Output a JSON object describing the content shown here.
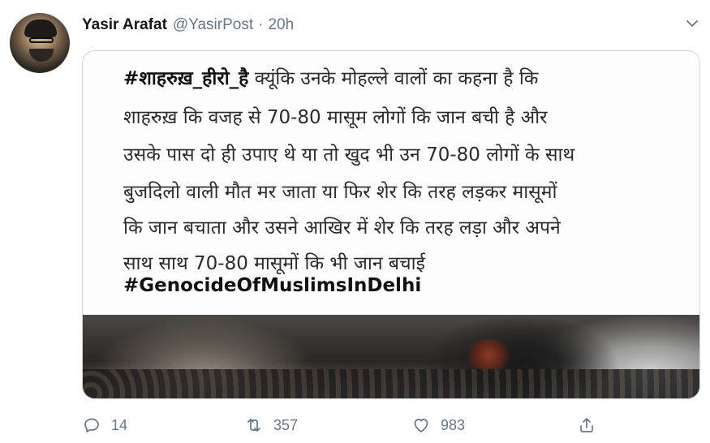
{
  "tweet": {
    "author": {
      "name": "Yasir Arafat",
      "handle": "@YasirPost",
      "separator": "·",
      "time": "20h"
    },
    "media_text": {
      "line1_hashtag": "#शाहरुख़_हीरो_है",
      "line1_rest": " क्यूंकि उनके मोहल्ले वालों का कहना है कि",
      "line2": "शाहरुख़ कि वजह से 70-80 मासूम लोगों कि जान बची है और",
      "line3": "उसके पास दो ही उपाए थे या तो खुद भी उन 70-80 लोगों के साथ",
      "line4": "बुजदिलो वाली मौत मर जाता या फिर शेर कि तरह लड़कर मासूमों",
      "line5": "कि जान बचाता और उसने आखिर में शेर कि तरह लड़ा और अपने",
      "line6": "साथ साथ 70-80 मासूमों कि भी जान बचाई",
      "line7": "#GenocideOfMuslimsInDelhi"
    },
    "actions": {
      "reply_count": "14",
      "retweet_count": "357",
      "like_count": "983"
    },
    "icons": {
      "more": "chevron-down-icon",
      "reply": "reply-icon",
      "retweet": "retweet-icon",
      "like": "heart-icon",
      "share": "share-icon"
    },
    "colors": {
      "secondary_text": "#657786",
      "border": "#ccd6dd"
    }
  }
}
